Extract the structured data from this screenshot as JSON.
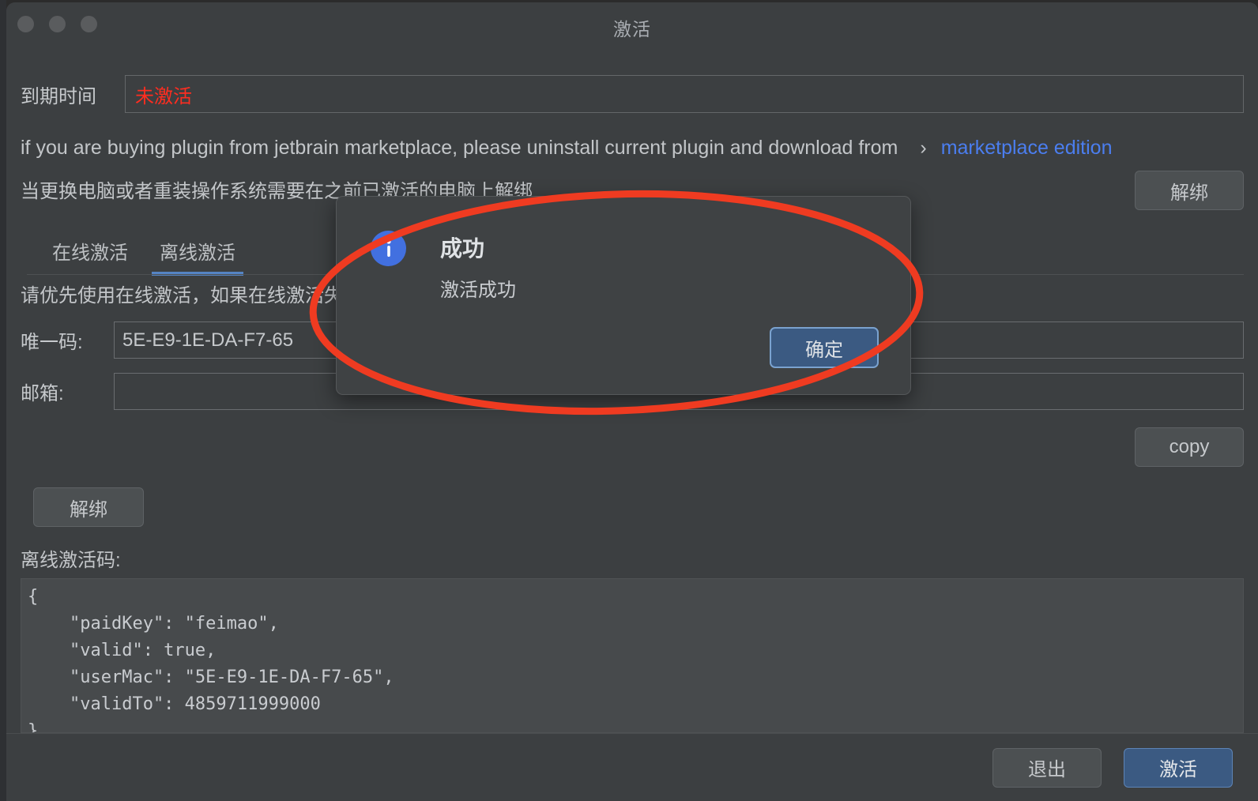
{
  "window": {
    "title": "激活",
    "traffic_lights": [
      "close-button",
      "minimize-button",
      "maximize-button"
    ]
  },
  "expiry": {
    "label": "到期时间",
    "value": "未激活",
    "value_color": "#ff2d20"
  },
  "marketplace_notice": {
    "text": "if you are buying plugin from jetbrain marketplace, please uninstall current plugin and download from",
    "chevron": "›",
    "link": "marketplace edition",
    "link_color": "#4b7ef0"
  },
  "unbind_notice": {
    "text": "当更换电脑或者重装操作系统需要在之前已激活的电脑上解绑",
    "button": "解绑"
  },
  "tabs": [
    {
      "label": "在线激活",
      "active": false
    },
    {
      "label": "离线激活",
      "active": true
    }
  ],
  "tab_hint": "请优先使用在线激活，如果在线激活失败，可以使用离线激活，邮箱会发离线激活码",
  "form": {
    "unique_code": {
      "label": "唯一码:",
      "value": "5E-E9-1E-DA-F7-65",
      "placeholder": ""
    },
    "email": {
      "label": "邮箱:",
      "value": "",
      "placeholder": ""
    },
    "copy_button": "copy",
    "unbind_button": "解绑"
  },
  "offline_code": {
    "label": "离线激活码:",
    "content": "{\n    \"paidKey\": \"feimao\",\n    \"valid\": true,\n    \"userMac\": \"5E-E9-1E-DA-F7-65\",\n    \"validTo\": 4859711999000\n}"
  },
  "footer": {
    "exit_button": "退出",
    "activate_button": "激活",
    "activate_color": "#3b5a82"
  },
  "modal": {
    "icon": "info-icon",
    "icon_color": "#4270e0",
    "title": "成功",
    "message": "激活成功",
    "ok_button": "确定"
  },
  "annotation": {
    "shape": "ellipse",
    "color": "#ef3b21"
  }
}
